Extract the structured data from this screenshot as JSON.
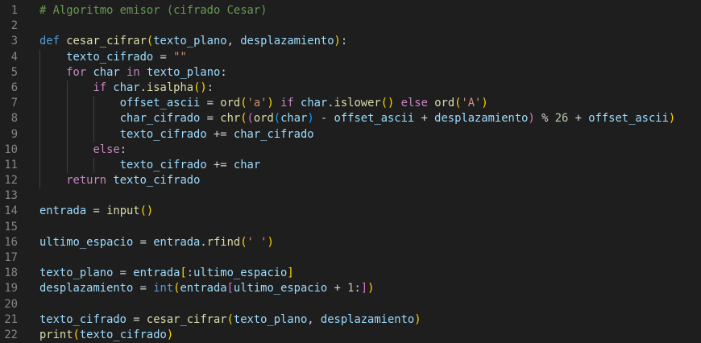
{
  "editor": {
    "language": "python",
    "colors": {
      "background": "#1e1e1e",
      "line_number": "#858585",
      "comment": "#6a9955",
      "keyword": "#569cd6",
      "control": "#c586c0",
      "function": "#dcdcaa",
      "variable": "#9cdcfe",
      "string": "#ce9178",
      "number": "#b5cea8",
      "bracket_level1": "#ffd700",
      "bracket_level2": "#da70d6",
      "bracket_level3": "#179fff"
    },
    "lines": [
      {
        "n": "1",
        "indent": 0,
        "tokens": [
          [
            "cm",
            "# Algoritmo emisor (cifrado Cesar)"
          ]
        ]
      },
      {
        "n": "2",
        "indent": 0,
        "tokens": []
      },
      {
        "n": "3",
        "indent": 0,
        "tokens": [
          [
            "kw",
            "def"
          ],
          [
            "pl",
            " "
          ],
          [
            "fn",
            "cesar_cifrar"
          ],
          [
            "b1",
            "("
          ],
          [
            "var",
            "texto_plano"
          ],
          [
            "pl",
            ", "
          ],
          [
            "var",
            "desplazamiento"
          ],
          [
            "b1",
            ")"
          ],
          [
            "pl",
            ":"
          ]
        ]
      },
      {
        "n": "4",
        "indent": 1,
        "tokens": [
          [
            "pl",
            "    "
          ],
          [
            "var",
            "texto_cifrado"
          ],
          [
            "op",
            " = "
          ],
          [
            "str",
            "\"\""
          ]
        ]
      },
      {
        "n": "5",
        "indent": 1,
        "tokens": [
          [
            "pl",
            "    "
          ],
          [
            "ctl",
            "for"
          ],
          [
            "pl",
            " "
          ],
          [
            "var",
            "char"
          ],
          [
            "pl",
            " "
          ],
          [
            "ctl",
            "in"
          ],
          [
            "pl",
            " "
          ],
          [
            "var",
            "texto_plano"
          ],
          [
            "pl",
            ":"
          ]
        ]
      },
      {
        "n": "6",
        "indent": 2,
        "tokens": [
          [
            "pl",
            "        "
          ],
          [
            "ctl",
            "if"
          ],
          [
            "pl",
            " "
          ],
          [
            "var",
            "char"
          ],
          [
            "pl",
            "."
          ],
          [
            "fn",
            "isalpha"
          ],
          [
            "b1",
            "()"
          ],
          [
            "pl",
            ":"
          ]
        ]
      },
      {
        "n": "7",
        "indent": 3,
        "tokens": [
          [
            "pl",
            "            "
          ],
          [
            "var",
            "offset_ascii"
          ],
          [
            "op",
            " = "
          ],
          [
            "fn",
            "ord"
          ],
          [
            "b1",
            "("
          ],
          [
            "str",
            "'a'"
          ],
          [
            "b1",
            ")"
          ],
          [
            "pl",
            " "
          ],
          [
            "ctl",
            "if"
          ],
          [
            "pl",
            " "
          ],
          [
            "var",
            "char"
          ],
          [
            "pl",
            "."
          ],
          [
            "fn",
            "islower"
          ],
          [
            "b1",
            "()"
          ],
          [
            "pl",
            " "
          ],
          [
            "ctl",
            "else"
          ],
          [
            "pl",
            " "
          ],
          [
            "fn",
            "ord"
          ],
          [
            "b1",
            "("
          ],
          [
            "str",
            "'A'"
          ],
          [
            "b1",
            ")"
          ]
        ]
      },
      {
        "n": "8",
        "indent": 3,
        "tokens": [
          [
            "pl",
            "            "
          ],
          [
            "var",
            "char_cifrado"
          ],
          [
            "op",
            " = "
          ],
          [
            "fn",
            "chr"
          ],
          [
            "b1",
            "("
          ],
          [
            "b2",
            "("
          ],
          [
            "fn",
            "ord"
          ],
          [
            "b3",
            "("
          ],
          [
            "var",
            "char"
          ],
          [
            "b3",
            ")"
          ],
          [
            "op",
            " - "
          ],
          [
            "var",
            "offset_ascii"
          ],
          [
            "op",
            " + "
          ],
          [
            "var",
            "desplazamiento"
          ],
          [
            "b2",
            ")"
          ],
          [
            "op",
            " % "
          ],
          [
            "num",
            "26"
          ],
          [
            "op",
            " + "
          ],
          [
            "var",
            "offset_ascii"
          ],
          [
            "b1",
            ")"
          ]
        ]
      },
      {
        "n": "9",
        "indent": 3,
        "tokens": [
          [
            "pl",
            "            "
          ],
          [
            "var",
            "texto_cifrado"
          ],
          [
            "op",
            " += "
          ],
          [
            "var",
            "char_cifrado"
          ]
        ]
      },
      {
        "n": "10",
        "indent": 2,
        "tokens": [
          [
            "pl",
            "        "
          ],
          [
            "ctl",
            "else"
          ],
          [
            "pl",
            ":"
          ]
        ]
      },
      {
        "n": "11",
        "indent": 3,
        "tokens": [
          [
            "pl",
            "            "
          ],
          [
            "var",
            "texto_cifrado"
          ],
          [
            "op",
            " += "
          ],
          [
            "var",
            "char"
          ]
        ]
      },
      {
        "n": "12",
        "indent": 1,
        "tokens": [
          [
            "pl",
            "    "
          ],
          [
            "ctl",
            "return"
          ],
          [
            "pl",
            " "
          ],
          [
            "var",
            "texto_cifrado"
          ]
        ]
      },
      {
        "n": "13",
        "indent": 0,
        "tokens": []
      },
      {
        "n": "14",
        "indent": 0,
        "tokens": [
          [
            "var",
            "entrada"
          ],
          [
            "op",
            " = "
          ],
          [
            "fn",
            "input"
          ],
          [
            "b1",
            "()"
          ]
        ]
      },
      {
        "n": "15",
        "indent": 0,
        "tokens": []
      },
      {
        "n": "16",
        "indent": 0,
        "tokens": [
          [
            "var",
            "ultimo_espacio"
          ],
          [
            "op",
            " = "
          ],
          [
            "var",
            "entrada"
          ],
          [
            "pl",
            "."
          ],
          [
            "fn",
            "rfind"
          ],
          [
            "b1",
            "("
          ],
          [
            "str",
            "' '"
          ],
          [
            "b1",
            ")"
          ]
        ]
      },
      {
        "n": "17",
        "indent": 0,
        "tokens": []
      },
      {
        "n": "18",
        "indent": 0,
        "tokens": [
          [
            "var",
            "texto_plano"
          ],
          [
            "op",
            " = "
          ],
          [
            "var",
            "entrada"
          ],
          [
            "b1",
            "["
          ],
          [
            "pl",
            ":"
          ],
          [
            "var",
            "ultimo_espacio"
          ],
          [
            "b1",
            "]"
          ]
        ]
      },
      {
        "n": "19",
        "indent": 0,
        "tokens": [
          [
            "var",
            "desplazamiento"
          ],
          [
            "op",
            " = "
          ],
          [
            "kw",
            "int"
          ],
          [
            "b1",
            "("
          ],
          [
            "var",
            "entrada"
          ],
          [
            "b2",
            "["
          ],
          [
            "var",
            "ultimo_espacio"
          ],
          [
            "op",
            " + "
          ],
          [
            "num",
            "1"
          ],
          [
            "pl",
            ":"
          ],
          [
            "b2",
            "]"
          ],
          [
            "b1",
            ")"
          ]
        ]
      },
      {
        "n": "20",
        "indent": 0,
        "tokens": []
      },
      {
        "n": "21",
        "indent": 0,
        "tokens": [
          [
            "var",
            "texto_cifrado"
          ],
          [
            "op",
            " = "
          ],
          [
            "fn",
            "cesar_cifrar"
          ],
          [
            "b1",
            "("
          ],
          [
            "var",
            "texto_plano"
          ],
          [
            "pl",
            ", "
          ],
          [
            "var",
            "desplazamiento"
          ],
          [
            "b1",
            ")"
          ]
        ]
      },
      {
        "n": "22",
        "indent": 0,
        "tokens": [
          [
            "fn",
            "print"
          ],
          [
            "b1",
            "("
          ],
          [
            "var",
            "texto_cifrado"
          ],
          [
            "b1",
            ")"
          ]
        ]
      }
    ]
  }
}
